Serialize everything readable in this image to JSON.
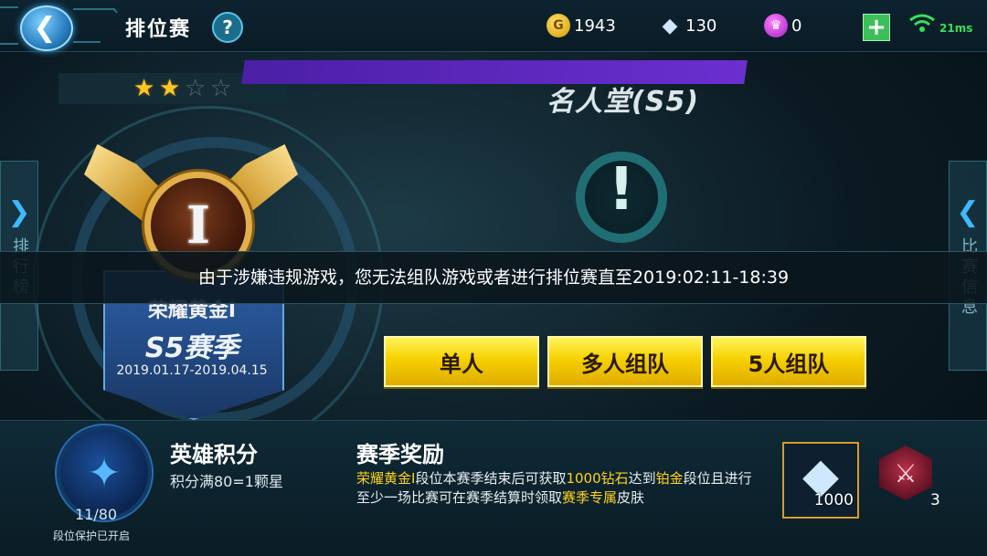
{
  "header": {
    "title": "排位赛",
    "help_label": "?",
    "gold": "1943",
    "diamonds": "130",
    "vouchers": "0",
    "add_label": "+",
    "ping": "21ms"
  },
  "side_tabs": {
    "left": "排行榜",
    "right": "比赛信息"
  },
  "rank": {
    "stars_filled": 2,
    "stars_total": 4,
    "emblem_numeral": "I",
    "tier_name": "荣耀黄金I",
    "season": "S5赛季",
    "season_dates": "2019.01.17-2019.04.15"
  },
  "hall_of_fame": {
    "title": "名人堂(S5)",
    "alert_mark": "!"
  },
  "ban_notice": "由于涉嫌违规游戏，您无法组队游戏或者进行排位赛直至2019:02:11-18:39",
  "modes": [
    "单人",
    "多人组队",
    "5人组队"
  ],
  "hero_points": {
    "title": "英雄积分",
    "rule": "积分满80=1颗星",
    "progress": "11/80",
    "protection": "段位保护已开启"
  },
  "season_reward": {
    "title": "赛季奖励",
    "desc_parts": [
      {
        "text": "荣耀黄金I",
        "hl": true
      },
      {
        "text": "段位本赛季结束后可获取",
        "hl": false
      },
      {
        "text": "1000钻石",
        "hl": true
      },
      {
        "text": "达到",
        "hl": false
      },
      {
        "text": "铂金",
        "hl": true
      },
      {
        "text": "段位且进行至少一场比赛可在赛季结算时领取",
        "hl": false
      },
      {
        "text": "赛季专属",
        "hl": true
      },
      {
        "text": "皮肤",
        "hl": false
      }
    ],
    "diamond_amount": "1000",
    "skin_count": "3"
  },
  "colors": {
    "accent_yellow": "#ffd21a",
    "button_yellow": "#f6d000",
    "banner_purple": "#5a27bd",
    "ping_green": "#37e05a"
  },
  "icons": {
    "back": "back-arrow-icon",
    "gold": "gold-coin-icon",
    "diamond": "diamond-icon",
    "voucher": "voucher-crown-icon",
    "wifi": "wifi-icon"
  }
}
